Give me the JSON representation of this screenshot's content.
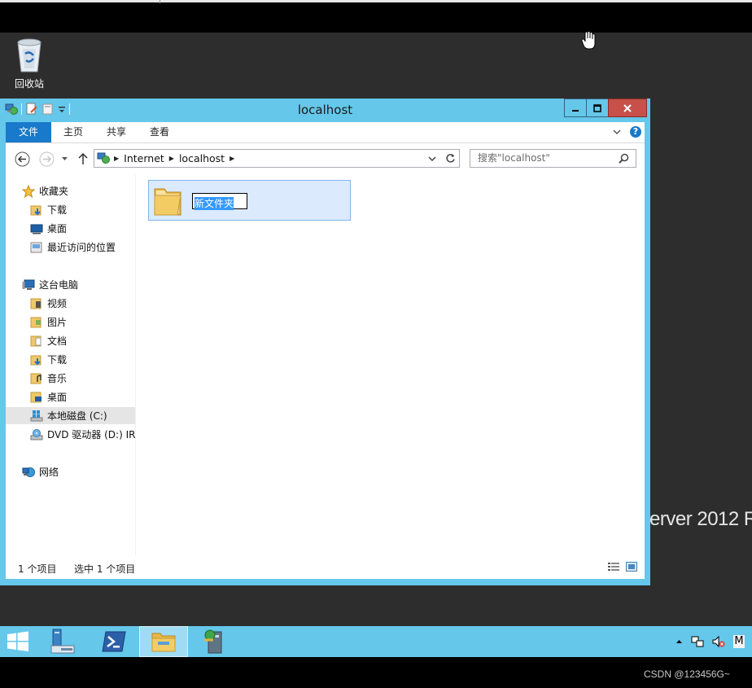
{
  "desktop": {
    "recycle_bin_label": "回收站",
    "background_text": "erver 2012 R"
  },
  "window": {
    "title": "localhost",
    "ribbon_tabs": [
      "文件",
      "主页",
      "共享",
      "查看"
    ],
    "help_label": "?",
    "address": {
      "crumbs": [
        "Internet",
        "localhost"
      ]
    },
    "search": {
      "placeholder": "搜索\"localhost\""
    },
    "nav": {
      "favorites": {
        "label": "收藏夹",
        "items": [
          "下载",
          "桌面",
          "最近访问的位置"
        ]
      },
      "this_pc": {
        "label": "这台电脑",
        "items": [
          "视频",
          "图片",
          "文档",
          "下载",
          "音乐",
          "桌面",
          "本地磁盘 (C:)",
          "DVD 驱动器 (D:) IR"
        ]
      },
      "network": {
        "label": "网络"
      }
    },
    "content": {
      "new_folder_name": "新文件夹"
    },
    "status": {
      "count": "1 个项目",
      "selected": "选中 1 个项目"
    }
  },
  "taskbar": {
    "tray_text": "M"
  },
  "watermark": "CSDN @123456G~",
  "colors": {
    "window_frame": "#65c7ea",
    "file_tab": "#1979ca",
    "close_button": "#c7504a",
    "selection": "#dbeafc",
    "text_selection": "#3399ff"
  }
}
